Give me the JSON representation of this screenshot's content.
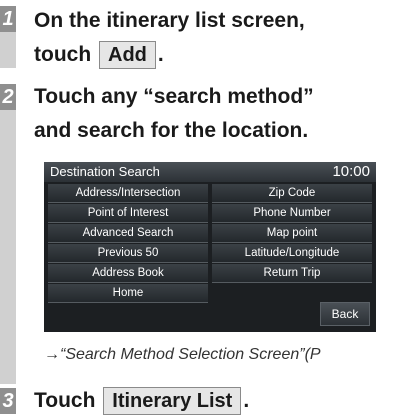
{
  "steps": [
    {
      "number": "1",
      "line1": "On the itinerary list screen,",
      "line2_prefix": "touch",
      "button": "Add",
      "line2_suffix": "."
    },
    {
      "number": "2",
      "line1": "Touch any “search method”",
      "line2": "and search for the location."
    },
    {
      "number": "3",
      "prefix": "Touch",
      "button": "Itinerary List",
      "suffix": "."
    }
  ],
  "screen": {
    "title": "Destination Search",
    "clock": "10:00",
    "left_options": [
      "Address/Intersection",
      "Point of Interest",
      "Advanced Search",
      "Previous 50",
      "Address Book",
      "Home"
    ],
    "right_options": [
      "Zip Code",
      "Phone Number",
      "Map point",
      "Latitude/Longitude",
      "Return Trip"
    ],
    "back_label": "Back"
  },
  "note": "→“Search Method Selection Screen”(P"
}
